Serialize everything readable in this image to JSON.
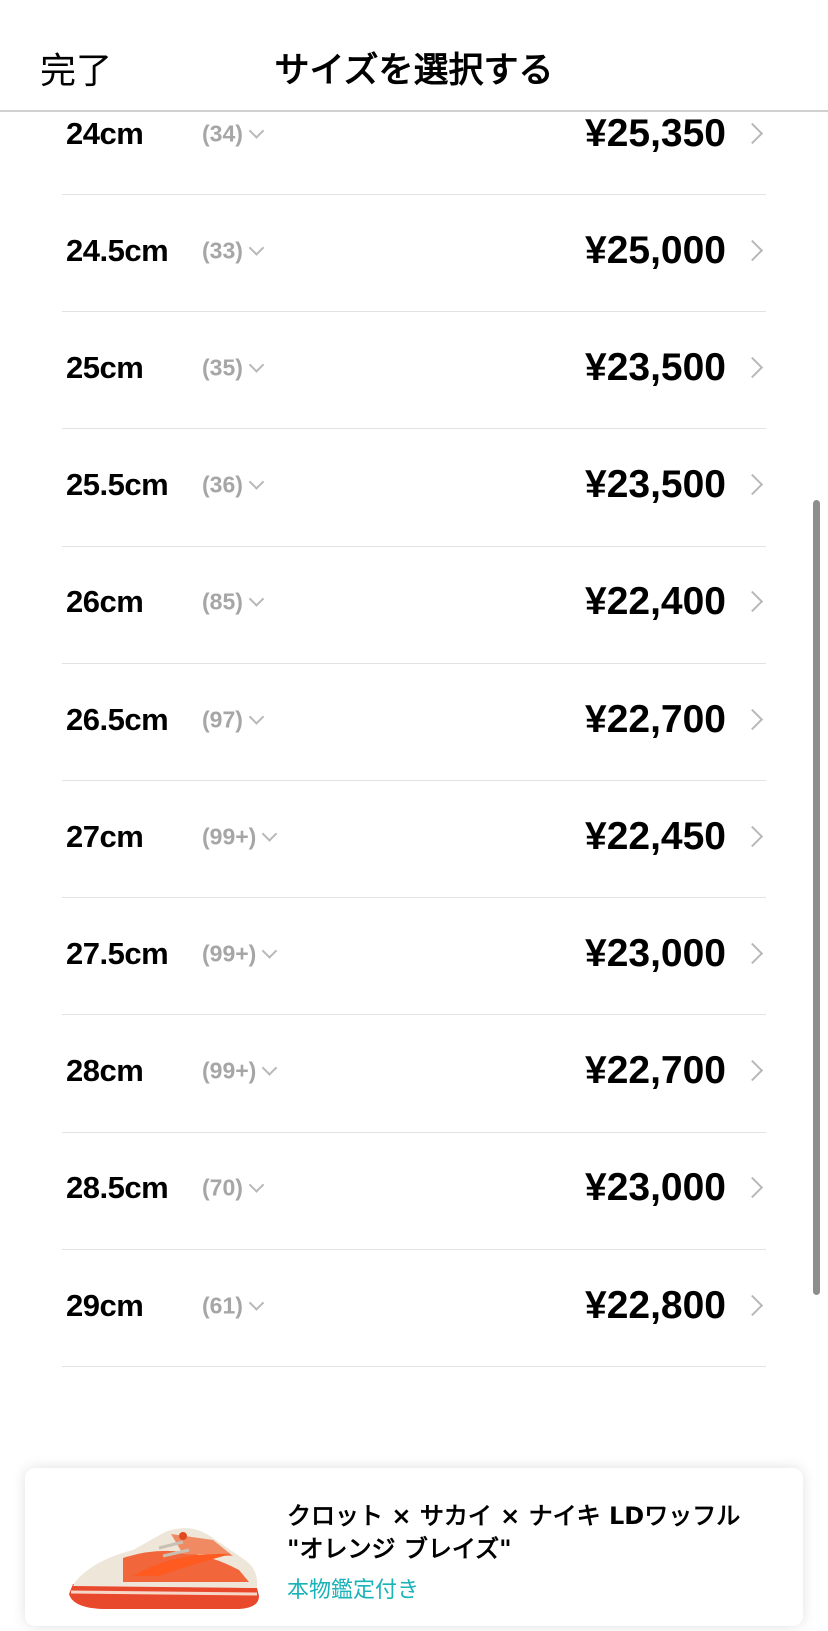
{
  "header": {
    "done_label": "完了",
    "title": "サイズを選択する"
  },
  "sizes": [
    {
      "size": "24cm",
      "count": "(34)",
      "price": "¥25,350"
    },
    {
      "size": "24.5cm",
      "count": "(33)",
      "price": "¥25,000"
    },
    {
      "size": "25cm",
      "count": "(35)",
      "price": "¥23,500"
    },
    {
      "size": "25.5cm",
      "count": "(36)",
      "price": "¥23,500"
    },
    {
      "size": "26cm",
      "count": "(85)",
      "price": "¥22,400"
    },
    {
      "size": "26.5cm",
      "count": "(97)",
      "price": "¥22,700"
    },
    {
      "size": "27cm",
      "count": "(99+)",
      "price": "¥22,450"
    },
    {
      "size": "27.5cm",
      "count": "(99+)",
      "price": "¥23,000"
    },
    {
      "size": "28cm",
      "count": "(99+)",
      "price": "¥22,700"
    },
    {
      "size": "28.5cm",
      "count": "(70)",
      "price": "¥23,000"
    },
    {
      "size": "29cm",
      "count": "(61)",
      "price": "¥22,800"
    }
  ],
  "product": {
    "name_line1": "クロット × サカイ × ナイキ LDワッフル",
    "name_line2": "\"オレンジ ブレイズ\"",
    "badge": "本物鑑定付き",
    "image_icon": "sneaker-image"
  },
  "colors": {
    "accent_teal": "#19b3b8",
    "count_gray": "#a6a6a6",
    "divider": "#e2e2e2"
  }
}
